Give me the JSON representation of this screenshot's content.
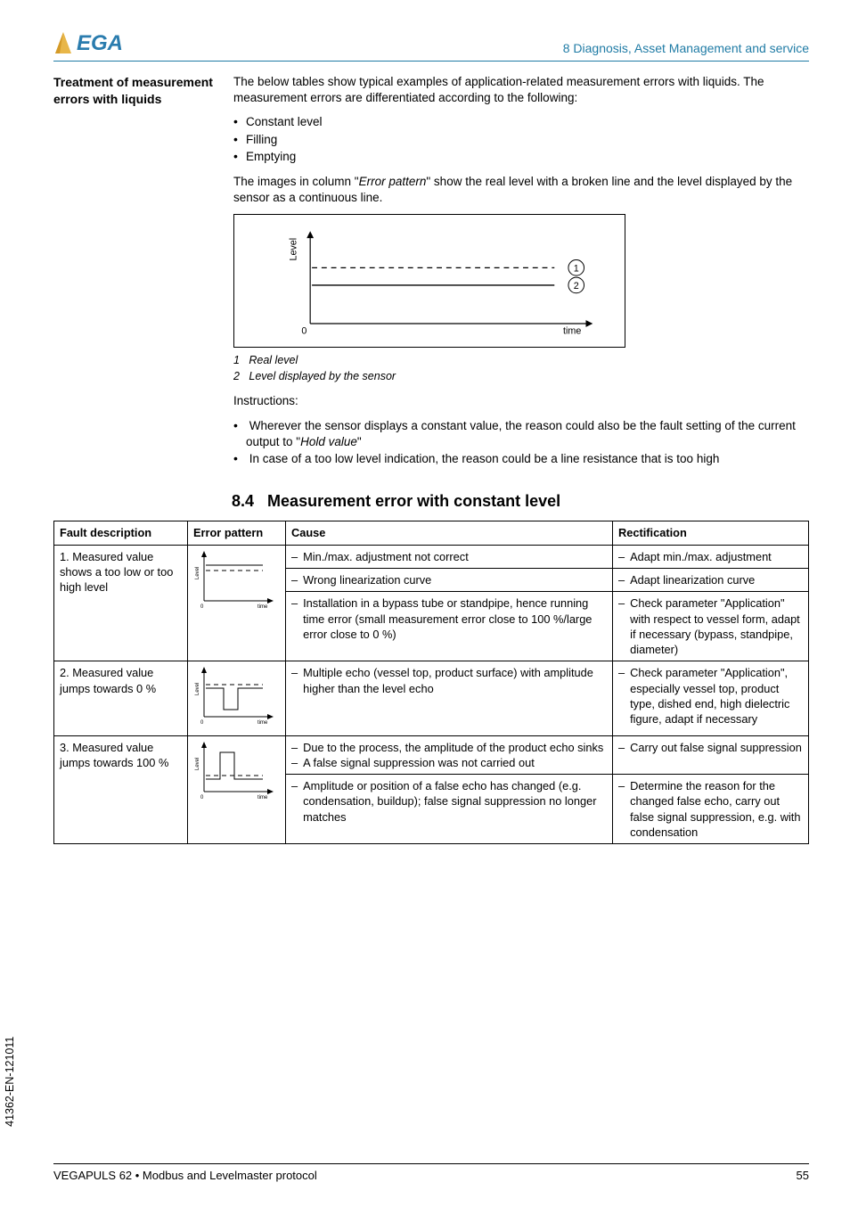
{
  "header": {
    "chapter": "8 Diagnosis, Asset Management and service"
  },
  "sideHeading": "Treatment of measurement errors with liquids",
  "intro": "The below tables show typical examples of application-related measurement errors with liquids. The measurement errors are differentiated according to the following:",
  "introBullets": [
    "Constant level",
    "Filling",
    "Emptying"
  ],
  "errorPatternPara_a": "The images in column \"",
  "errorPatternPara_i": "Error pattern",
  "errorPatternPara_b": "\" show the real level with a broken line and the level displayed by the sensor as a continuous line.",
  "chart": {
    "yLabel": "Level",
    "xLabel": "time",
    "zero": "0",
    "marker1": "1",
    "marker2": "2"
  },
  "captions": {
    "c1n": "1",
    "c1t": "Real level",
    "c2n": "2",
    "c2t": "Level displayed by the sensor"
  },
  "instrLabel": "Instructions:",
  "instrBullets": [
    {
      "pre": "Wherever the sensor displays a constant value, the reason could also be the fault setting of the current output to \"",
      "it": "Hold value",
      "post": "\""
    },
    {
      "pre": "In case of a too low level indication, the reason could be a line resistance that is too high",
      "it": "",
      "post": ""
    }
  ],
  "sectionNum": "8.4",
  "sectionTitle": "Measurement error with constant level",
  "table": {
    "headers": {
      "desc": "Fault description",
      "pat": "Error pattern",
      "cause": "Cause",
      "rect": "Rectification"
    },
    "rows": [
      {
        "desc": "1. Measured value shows a too low or too high level",
        "patternType": "flat-mid",
        "cells": [
          {
            "cause": "Min./max. adjustment not correct",
            "rect": "Adapt min./max. adjustment"
          },
          {
            "cause": "Wrong linearization curve",
            "rect": "Adapt linearization curve"
          },
          {
            "cause": "Installation in a bypass tube or standpipe, hence running time error (small measurement error close to 100 %/large error close to 0 %)",
            "rect": "Check parameter \"Application\" with respect to vessel form, adapt if necessary (bypass, standpipe, diameter)"
          }
        ]
      },
      {
        "desc": "2. Measured value jumps towards 0 %",
        "patternType": "dip",
        "cells": [
          {
            "cause": "Multiple echo (vessel top, product surface) with amplitude higher than the level echo",
            "rect": "Check parameter \"Application\", especially vessel top, product type, dished end, high dielectric figure, adapt if necessary"
          }
        ]
      },
      {
        "desc": "3. Measured value jumps towards 100 %",
        "patternType": "spike",
        "cells": [
          {
            "cause": "Due to the process, the amplitude of the product echo sinks",
            "cause2": "A false signal suppression was not carried out",
            "rect": "Carry out false signal suppression"
          },
          {
            "cause": "Amplitude or position of a false echo has changed (e.g. condensation, buildup); false signal suppression no longer matches",
            "rect": "Determine the reason for the changed false echo, carry out false signal suppression, e.g. with condensation"
          }
        ]
      }
    ]
  },
  "footer": {
    "product": "VEGAPULS 62 • Modbus and Levelmaster protocol",
    "page": "55"
  },
  "sideCode": "41362-EN-121011"
}
